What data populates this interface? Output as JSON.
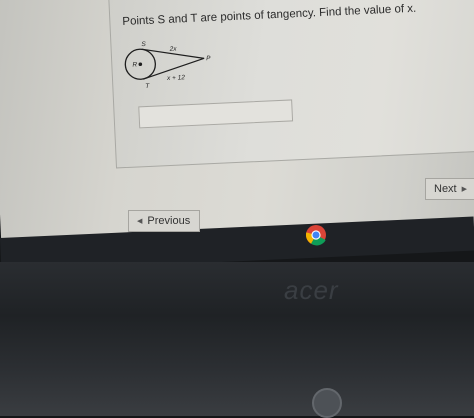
{
  "question": {
    "text": "Points S and T are points of tangency.  Find the value of x."
  },
  "figure": {
    "label_s": "S",
    "label_t": "T",
    "label_r": "R",
    "label_p": "P",
    "label_top": "2x",
    "label_bottom": "x + 12"
  },
  "answer": {
    "value": "",
    "placeholder": ""
  },
  "nav": {
    "next_label": "Next",
    "previous_label": "Previous"
  },
  "taskbar": {
    "icon": "chrome-icon"
  },
  "bezel": {
    "brand": "acer"
  },
  "colors": {
    "page_bg": "#dededa",
    "bezel": "#1f2225"
  }
}
